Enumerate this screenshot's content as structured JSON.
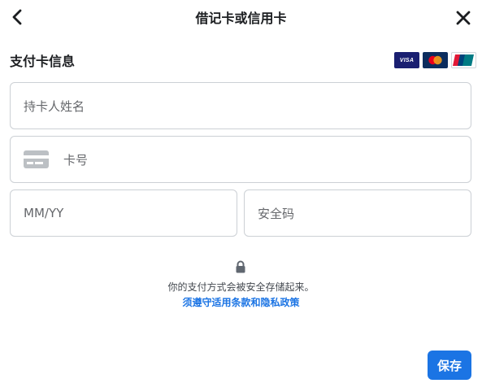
{
  "header": {
    "title": "借记卡或信用卡",
    "back_icon": "chevron-left-icon",
    "close_icon": "close-icon"
  },
  "section": {
    "title": "支付卡信息",
    "card_logos": [
      "VISA",
      "Mastercard",
      "UnionPay"
    ],
    "visa_text": "VISA"
  },
  "form": {
    "name_placeholder": "持卡人姓名",
    "card_number_placeholder": "卡号",
    "expiry_placeholder": "MM/YY",
    "cvv_placeholder": "安全码"
  },
  "footer": {
    "secure_text": "你的支付方式会被安全存储起来。",
    "policy_link": "须遵守适用条款和隐私政策",
    "save_label": "保存"
  },
  "colors": {
    "accent": "#1b74e4",
    "border": "#ccd0d5",
    "placeholder": "#65676b"
  }
}
